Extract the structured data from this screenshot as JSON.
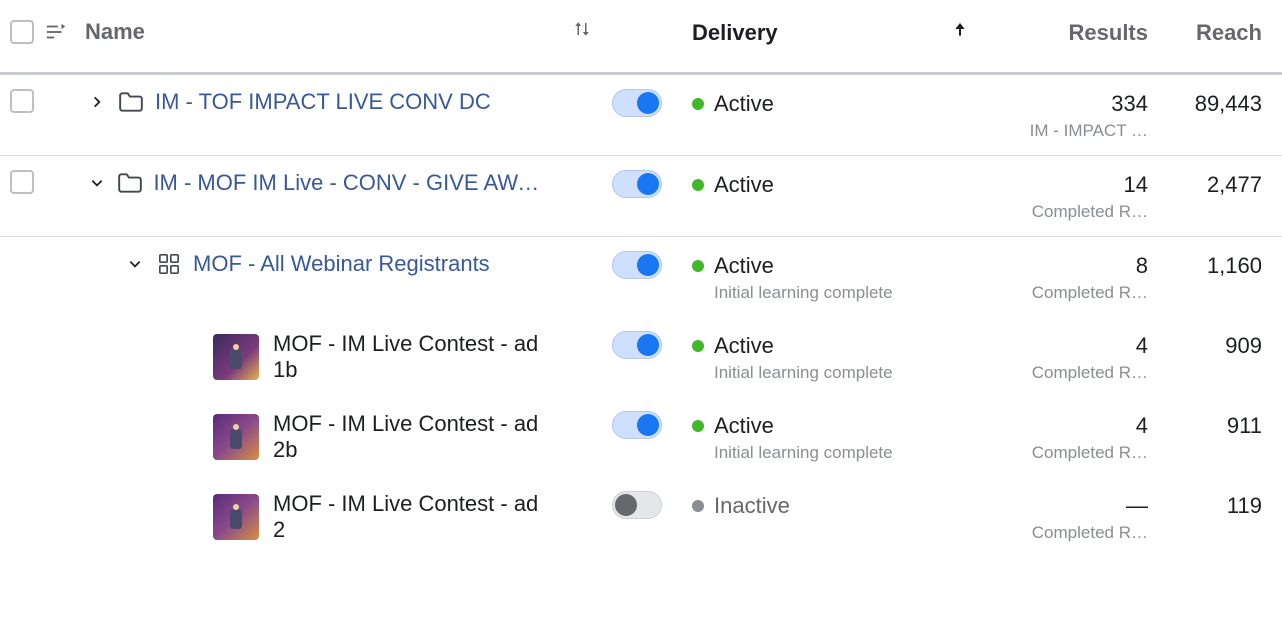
{
  "headers": {
    "name": "Name",
    "delivery": "Delivery",
    "results": "Results",
    "reach": "Reach"
  },
  "rows": [
    {
      "type": "campaign",
      "expanded": false,
      "name": "IM - TOF IMPACT LIVE CONV DC",
      "toggle_on": true,
      "status": "Active",
      "status_kind": "active",
      "sub_status": "",
      "results": "334",
      "results_sub": "IM - IMPACT …",
      "reach": "89,443"
    },
    {
      "type": "campaign",
      "expanded": true,
      "name": "IM - MOF IM Live - CONV - GIVE AWA…",
      "toggle_on": true,
      "status": "Active",
      "status_kind": "active",
      "sub_status": "",
      "results": "14",
      "results_sub": "Completed R…",
      "reach": "2,477"
    },
    {
      "type": "adset",
      "expanded": true,
      "name": "MOF - All Webinar Registrants",
      "toggle_on": true,
      "status": "Active",
      "status_kind": "active",
      "sub_status": "Initial learning complete",
      "results": "8",
      "results_sub": "Completed R…",
      "reach": "1,160"
    },
    {
      "type": "ad",
      "name": "MOF - IM Live Contest - ad 1b",
      "toggle_on": true,
      "status": "Active",
      "status_kind": "active",
      "sub_status": "Initial learning complete",
      "results": "4",
      "results_sub": "Completed R…",
      "reach": "909",
      "thumb_variant": ""
    },
    {
      "type": "ad",
      "name": "MOF - IM Live Contest - ad 2b",
      "toggle_on": true,
      "status": "Active",
      "status_kind": "active",
      "sub_status": "Initial learning complete",
      "results": "4",
      "results_sub": "Completed R…",
      "reach": "911",
      "thumb_variant": "alt"
    },
    {
      "type": "ad",
      "name": "MOF - IM Live Contest - ad 2",
      "toggle_on": false,
      "status": "Inactive",
      "status_kind": "inactive",
      "sub_status": "",
      "results": "—",
      "results_sub": "Completed R…",
      "reach": "119",
      "thumb_variant": "alt"
    }
  ]
}
